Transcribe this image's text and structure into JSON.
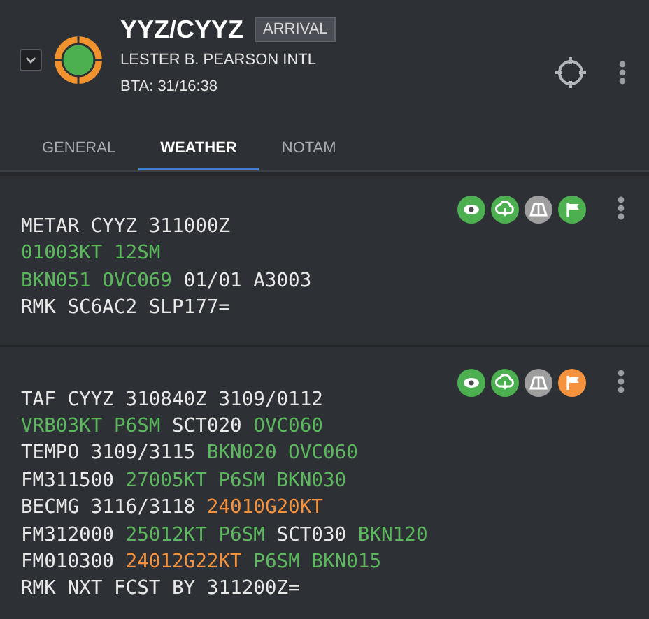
{
  "header": {
    "code": "YYZ/CYYZ",
    "badge": "ARRIVAL",
    "name": "LESTER B. PEARSON INTL",
    "eta": "BTA: 31/16:38",
    "expanded": false
  },
  "tabs": [
    {
      "label": "GENERAL",
      "selected": false
    },
    {
      "label": "WEATHER",
      "selected": true
    },
    {
      "label": "NOTAM",
      "selected": false
    }
  ],
  "reports": [
    {
      "status_icons": [
        {
          "kind": "visibility",
          "color": "#4caf50"
        },
        {
          "kind": "ceiling",
          "color": "#4caf50"
        },
        {
          "kind": "runway",
          "color": "#9e9e9e"
        },
        {
          "kind": "wind",
          "color": "#4caf50"
        }
      ],
      "lines": [
        [
          {
            "text": "METAR CYYZ 311000Z",
            "color": "#e8e8e8"
          }
        ],
        [
          {
            "text": "01003KT 12SM",
            "color": "#5cb85c"
          }
        ],
        [
          {
            "text": "BKN051 OVC069",
            "color": "#5cb85c"
          },
          {
            "text": " 01/01 A3003",
            "color": "#e8e8e8"
          }
        ],
        [
          {
            "text": "RMK SC6AC2 SLP177=",
            "color": "#e8e8e8"
          }
        ]
      ]
    },
    {
      "status_icons": [
        {
          "kind": "visibility",
          "color": "#4caf50"
        },
        {
          "kind": "ceiling",
          "color": "#4caf50"
        },
        {
          "kind": "runway",
          "color": "#9e9e9e"
        },
        {
          "kind": "wind",
          "color": "#f5923e"
        }
      ],
      "lines": [
        [
          {
            "text": "TAF CYYZ 310840Z 3109/0112",
            "color": "#e8e8e8"
          }
        ],
        [
          {
            "text": "VRB03KT P6SM",
            "color": "#5cb85c"
          },
          {
            "text": " SCT020 ",
            "color": "#e8e8e8"
          },
          {
            "text": "OVC060",
            "color": "#5cb85c"
          }
        ],
        [
          {
            "text": "TEMPO 3109/3115 ",
            "color": "#e8e8e8"
          },
          {
            "text": "BKN020 OVC060",
            "color": "#5cb85c"
          }
        ],
        [
          {
            "text": "FM311500 ",
            "color": "#e8e8e8"
          },
          {
            "text": "27005KT P6SM BKN030",
            "color": "#5cb85c"
          }
        ],
        [
          {
            "text": "BECMG 3116/3118 ",
            "color": "#e8e8e8"
          },
          {
            "text": "24010G20KT",
            "color": "#f5923e"
          }
        ],
        [
          {
            "text": "FM312000 ",
            "color": "#e8e8e8"
          },
          {
            "text": "25012KT P6SM",
            "color": "#5cb85c"
          },
          {
            "text": " SCT030 ",
            "color": "#e8e8e8"
          },
          {
            "text": "BKN120",
            "color": "#5cb85c"
          }
        ],
        [
          {
            "text": "FM010300 ",
            "color": "#e8e8e8"
          },
          {
            "text": "24012G22KT",
            "color": "#f5923e"
          },
          {
            "text": " P6SM BKN015",
            "color": "#5cb85c"
          }
        ],
        [
          {
            "text": "RMK NXT FCST BY 311200Z=",
            "color": "#e8e8e8"
          }
        ]
      ]
    }
  ]
}
